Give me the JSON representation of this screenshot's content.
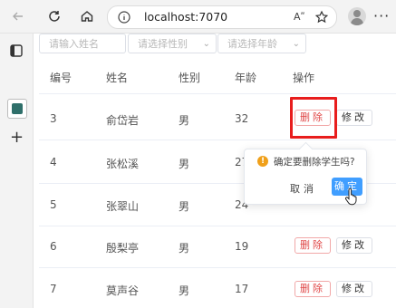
{
  "browser": {
    "url": "localhost:7070",
    "read_aloud": "Aʺ",
    "more": "···"
  },
  "filters": {
    "name_placeholder": "请输入姓名",
    "gender_placeholder": "请选择性别",
    "age_placeholder": "请选择年龄"
  },
  "table": {
    "headers": [
      "编号",
      "姓名",
      "性别",
      "年龄",
      "操作"
    ],
    "rows": [
      {
        "id": "3",
        "name": "俞岱岩",
        "gender": "男",
        "age": "32"
      },
      {
        "id": "4",
        "name": "张松溪",
        "gender": "男",
        "age": "27"
      },
      {
        "id": "5",
        "name": "张翠山",
        "gender": "男",
        "age": "24"
      },
      {
        "id": "6",
        "name": "殷梨亭",
        "gender": "男",
        "age": "19"
      },
      {
        "id": "7",
        "name": "莫声谷",
        "gender": "男",
        "age": "17"
      }
    ],
    "delete_label": "删除",
    "edit_label": "修改"
  },
  "popconfirm": {
    "message": "确定要删除学生吗?",
    "icon": "!",
    "cancel_label": "取消",
    "confirm_label": "确定"
  },
  "colors": {
    "danger": "#e04848",
    "primary": "#409eff",
    "highlight": "#e81d1d",
    "warning": "#f0a01a"
  }
}
